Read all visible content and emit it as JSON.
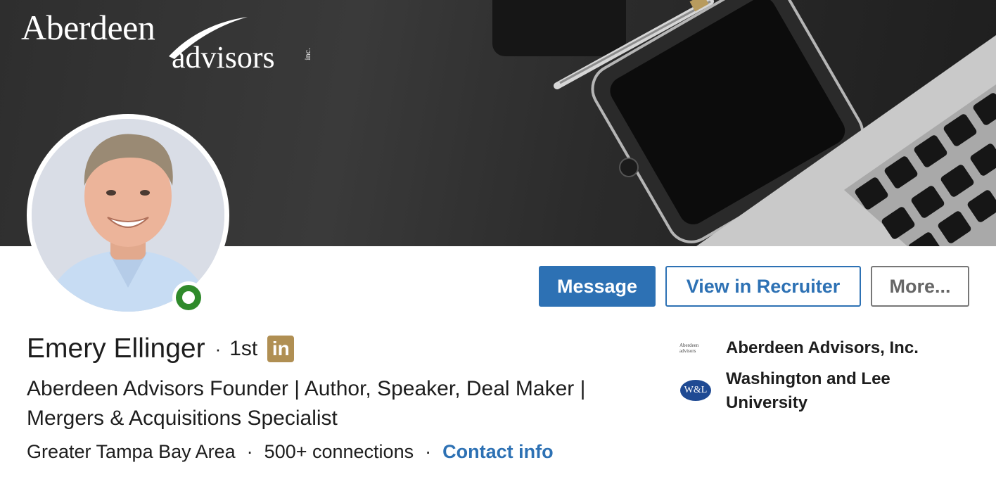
{
  "banner": {
    "logo_main": "Aberdeen",
    "logo_sub": "advisors",
    "logo_suffix": "inc."
  },
  "profile": {
    "name": "Emery Ellinger",
    "separator": "·",
    "degree": "1st",
    "premium_badge": "in",
    "headline": "Aberdeen Advisors Founder | Author, Speaker, Deal Maker | Mergers & Acquisitions Specialist",
    "location": "Greater Tampa Bay Area",
    "connections": "500+ connections",
    "contact_info": "Contact info",
    "status": "online"
  },
  "actions": {
    "message": "Message",
    "view_in_recruiter": "View in Recruiter",
    "more": "More..."
  },
  "affiliations": [
    {
      "name": "Aberdeen Advisors, Inc.",
      "logo_text": "Aberdeen advisors"
    },
    {
      "name": "Washington and Lee University",
      "logo_text": "W&L"
    }
  ],
  "colors": {
    "primary_blue": "#2d71b4",
    "online_green": "#2f8a2b",
    "premium_gold": "#b08f53"
  },
  "icons": {
    "premium": "linkedin-premium-icon",
    "presence": "online-status-icon"
  }
}
